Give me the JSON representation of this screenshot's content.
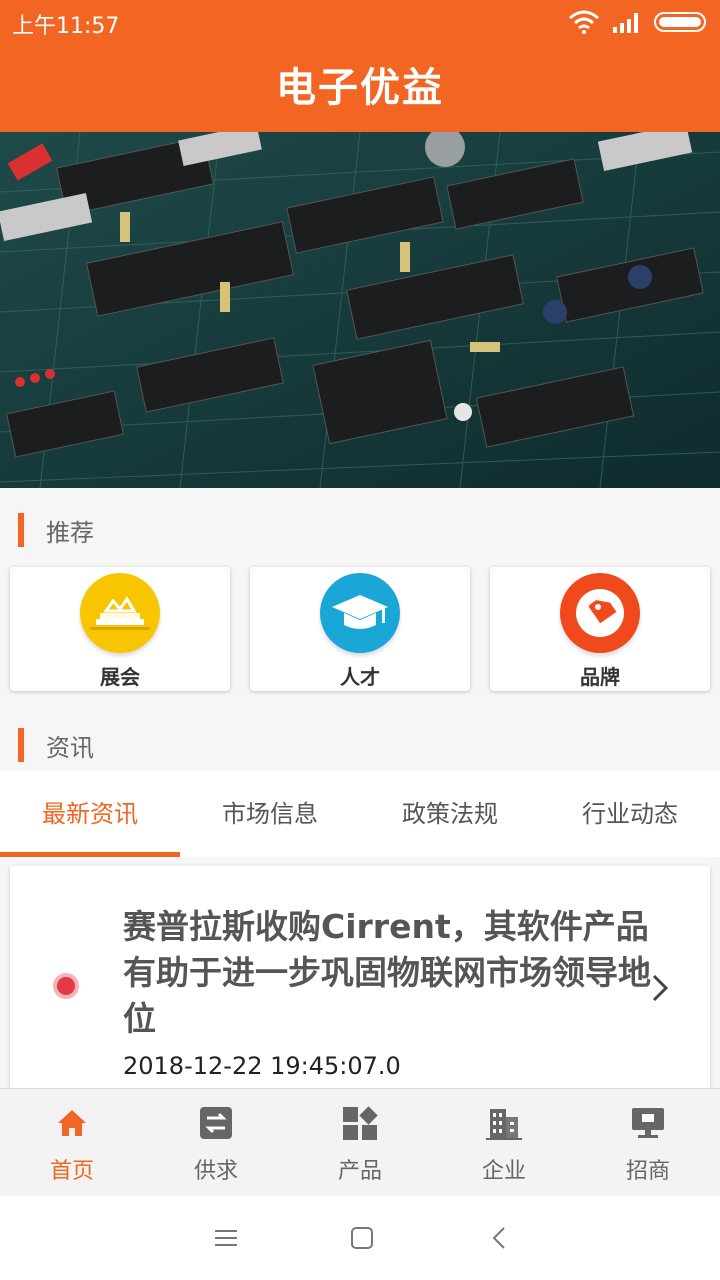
{
  "status_bar": {
    "time": "上午11:57",
    "icons": [
      "wifi-icon",
      "signal-icon",
      "battery-icon"
    ]
  },
  "header": {
    "title": "电子优益"
  },
  "banner": {
    "image": "circuit-board-photo",
    "indicator_count": 1
  },
  "recommend": {
    "title": "推荐",
    "items": [
      {
        "label": "展会",
        "icon": "exhibition-icon",
        "color": "#f7c600"
      },
      {
        "label": "人才",
        "icon": "graduation-cap-icon",
        "color": "#1aa7d8"
      },
      {
        "label": "品牌",
        "icon": "tag-icon",
        "color": "#f04a1c"
      }
    ]
  },
  "news": {
    "title": "资讯",
    "tabs": [
      "最新资讯",
      "市场信息",
      "政策法规",
      "行业动态"
    ],
    "active_tab": 0,
    "items": [
      {
        "headline": "赛普拉斯收购Cirrent，其软件产品有助于进一步巩固物联网市场领导地位",
        "time": "2018-12-22 19:45:07.0"
      }
    ]
  },
  "bottom_nav": {
    "items": [
      {
        "label": "首页",
        "icon": "home-icon"
      },
      {
        "label": "供求",
        "icon": "exchange-icon"
      },
      {
        "label": "产品",
        "icon": "products-icon"
      },
      {
        "label": "企业",
        "icon": "building-icon"
      },
      {
        "label": "招商",
        "icon": "monitor-icon"
      }
    ],
    "active": 0
  },
  "colors": {
    "accent": "#f26522",
    "inactive": "#666666"
  }
}
